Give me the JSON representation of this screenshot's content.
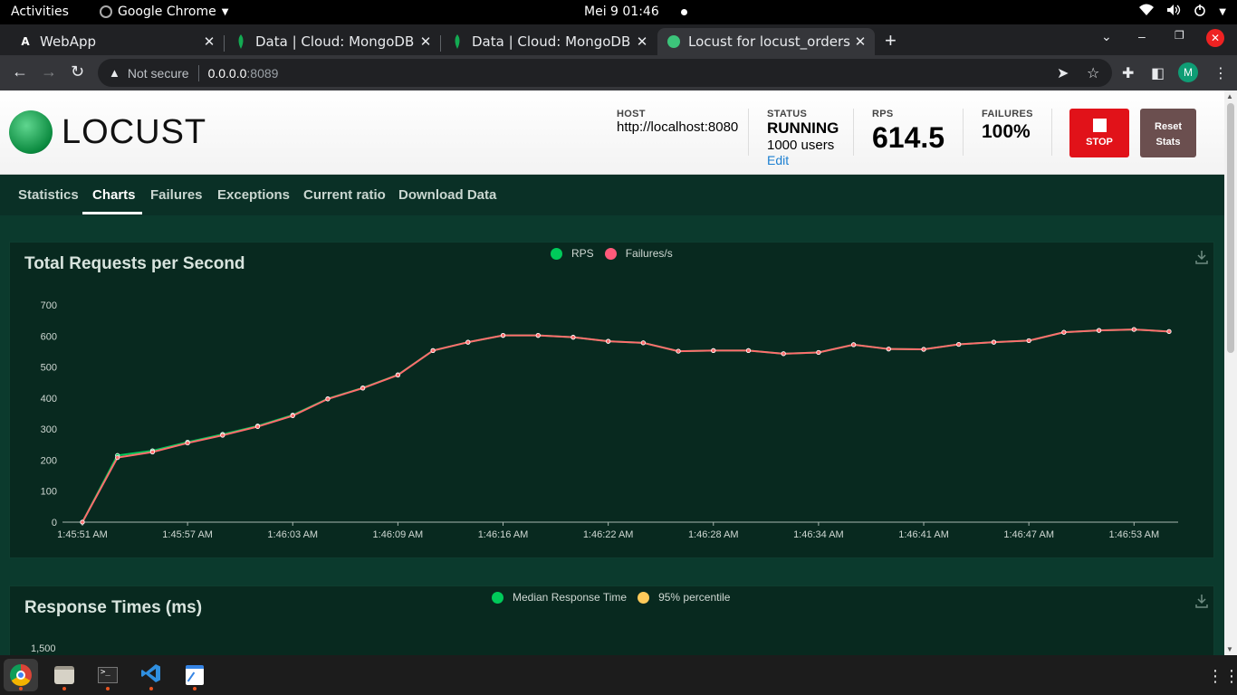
{
  "system": {
    "activities": "Activities",
    "app_name": "Google Chrome",
    "clock": "Mei 9  01:46"
  },
  "browser": {
    "tabs": [
      {
        "title": "WebApp",
        "active": false
      },
      {
        "title": "Data | Cloud: MongoDB Cl",
        "active": false
      },
      {
        "title": "Data | Cloud: MongoDB Cl",
        "active": false
      },
      {
        "title": "Locust for locust_orders.p",
        "active": true
      }
    ],
    "address": {
      "security_label": "Not secure",
      "host": "0.0.0.0",
      "port": ":8089"
    },
    "profile_initial": "M"
  },
  "locust": {
    "logo_text": "LOCUST",
    "host_label": "HOST",
    "host_value": "http://localhost:8080",
    "status_label": "STATUS",
    "status_value": "RUNNING",
    "users_value": "1000 users",
    "edit_label": "Edit",
    "rps_label": "RPS",
    "rps_value": "614.5",
    "failures_label": "FAILURES",
    "failures_value": "100%",
    "stop_label": "STOP",
    "reset_label_1": "Reset",
    "reset_label_2": "Stats",
    "nav": [
      "Statistics",
      "Charts",
      "Failures",
      "Exceptions",
      "Current ratio",
      "Download Data"
    ],
    "active_nav": "Charts"
  },
  "chart_data": [
    {
      "type": "line",
      "title": "Total Requests per Second",
      "x_tick_labels": [
        "1:45:51 AM",
        "1:45:57 AM",
        "1:46:03 AM",
        "1:46:09 AM",
        "1:46:16 AM",
        "1:46:22 AM",
        "1:46:28 AM",
        "1:46:34 AM",
        "1:46:41 AM",
        "1:46:47 AM",
        "1:46:53 AM"
      ],
      "y_tick_labels": [
        "0",
        "100",
        "200",
        "300",
        "400",
        "500",
        "600",
        "700"
      ],
      "ylim": [
        0,
        700
      ],
      "legend_position": "top-center",
      "series": [
        {
          "name": "RPS",
          "color": "#00ca5a",
          "values": [
            0,
            215,
            230,
            258,
            283,
            310,
            345,
            398,
            433,
            475,
            553,
            580,
            602,
            602,
            596,
            583,
            578,
            551,
            553,
            553,
            543,
            547,
            572,
            558,
            557,
            573,
            580,
            585,
            612,
            618,
            621,
            614.5
          ]
        },
        {
          "name": "Failures/s",
          "color": "#ff6d6d",
          "values": [
            0,
            208,
            226,
            255,
            280,
            308,
            343,
            397,
            432,
            474,
            553,
            580,
            602,
            602,
            596,
            583,
            578,
            551,
            553,
            553,
            543,
            547,
            572,
            558,
            557,
            573,
            580,
            585,
            612,
            618,
            621,
            614.5
          ]
        }
      ]
    },
    {
      "type": "line",
      "title": "Response Times (ms)",
      "y_tick_labels": [
        "1,500"
      ],
      "legend_position": "top-center",
      "series": [
        {
          "name": "Median Response Time",
          "color": "#00ca5a",
          "values": []
        },
        {
          "name": "95% percentile",
          "color": "#ffca5a",
          "values": []
        }
      ]
    }
  ]
}
